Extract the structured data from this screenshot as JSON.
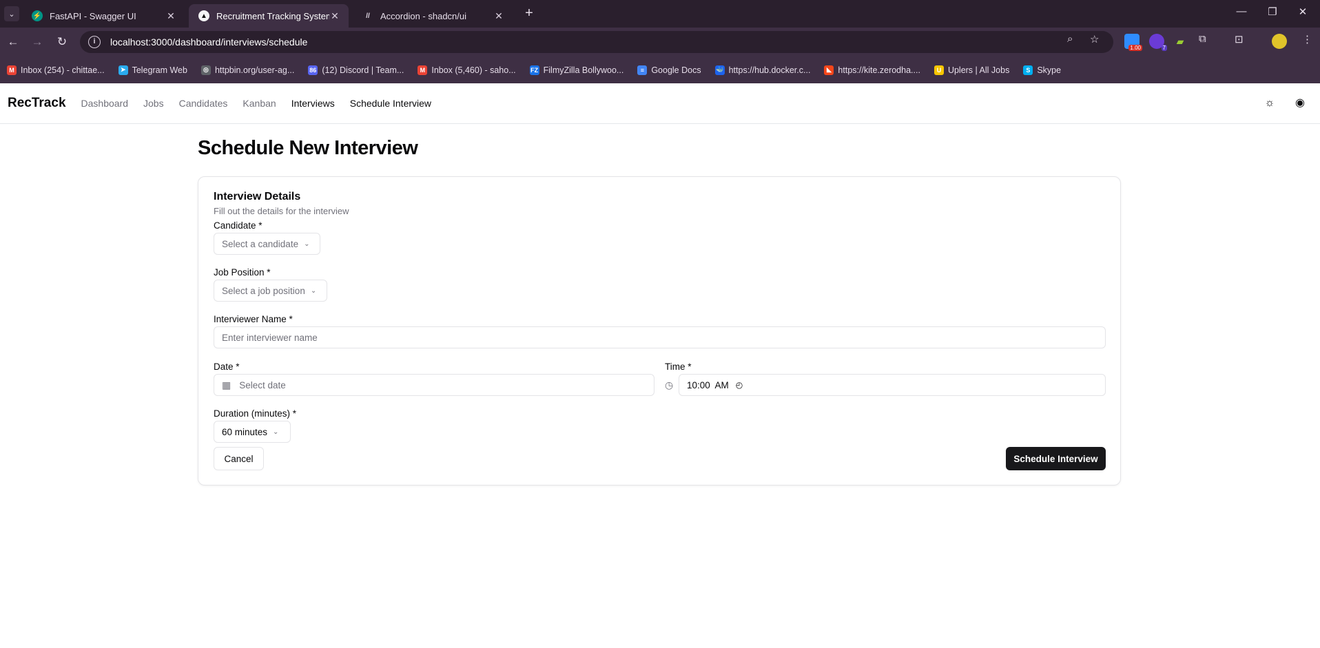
{
  "browser": {
    "tabs": [
      {
        "title": "FastAPI - Swagger UI",
        "fav_color": "#009485",
        "fav_glyph": "⚡"
      },
      {
        "title": "Recruitment Tracking System",
        "fav_color": "#111111",
        "fav_glyph": "▲"
      },
      {
        "title": "Accordion - shadcn/ui",
        "fav_color": "#2a1f2d",
        "fav_glyph": "//"
      }
    ],
    "url": "localhost:3000/dashboard/interviews/schedule",
    "extension_badges": [
      "1.00",
      "7"
    ],
    "bookmarks": [
      {
        "label": "Inbox (254) - chittae...",
        "color": "#ea4335",
        "glyph": "M"
      },
      {
        "label": "Telegram Web",
        "color": "#2aabee",
        "glyph": "➤"
      },
      {
        "label": "httpbin.org/user-ag...",
        "color": "#5f6368",
        "glyph": "◎"
      },
      {
        "label": "(12) Discord | Team...",
        "color": "#5865f2",
        "glyph": "86"
      },
      {
        "label": "Inbox (5,460) - saho...",
        "color": "#ea4335",
        "glyph": "M"
      },
      {
        "label": "FilmyZilla Bollywoo...",
        "color": "#1a73e8",
        "glyph": "FZ"
      },
      {
        "label": "Google Docs",
        "color": "#4285f4",
        "glyph": "≡"
      },
      {
        "label": "https://hub.docker.c...",
        "color": "#1d63ed",
        "glyph": "🐳"
      },
      {
        "label": "https://kite.zerodha....",
        "color": "#f6461a",
        "glyph": "◣"
      },
      {
        "label": "Uplers | All Jobs",
        "color": "#f7c600",
        "glyph": "U"
      },
      {
        "label": "Skype",
        "color": "#00aff0",
        "glyph": "S"
      }
    ]
  },
  "app": {
    "brand": "RecTrack",
    "nav": [
      "Dashboard",
      "Jobs",
      "Candidates",
      "Kanban",
      "Interviews",
      "Schedule Interview"
    ],
    "page_title": "Schedule New Interview",
    "card": {
      "title": "Interview Details",
      "description": "Fill out the details for the interview",
      "candidate_label": "Candidate *",
      "candidate_placeholder": "Select a candidate",
      "job_label": "Job Position *",
      "job_placeholder": "Select a job position",
      "interviewer_label": "Interviewer Name *",
      "interviewer_placeholder": "Enter interviewer name",
      "date_label": "Date *",
      "date_placeholder": "Select date",
      "time_label": "Time *",
      "time_value": "10:00  AM",
      "duration_label": "Duration (minutes) *",
      "duration_value": "60 minutes",
      "cancel_label": "Cancel",
      "submit_label": "Schedule Interview"
    }
  }
}
